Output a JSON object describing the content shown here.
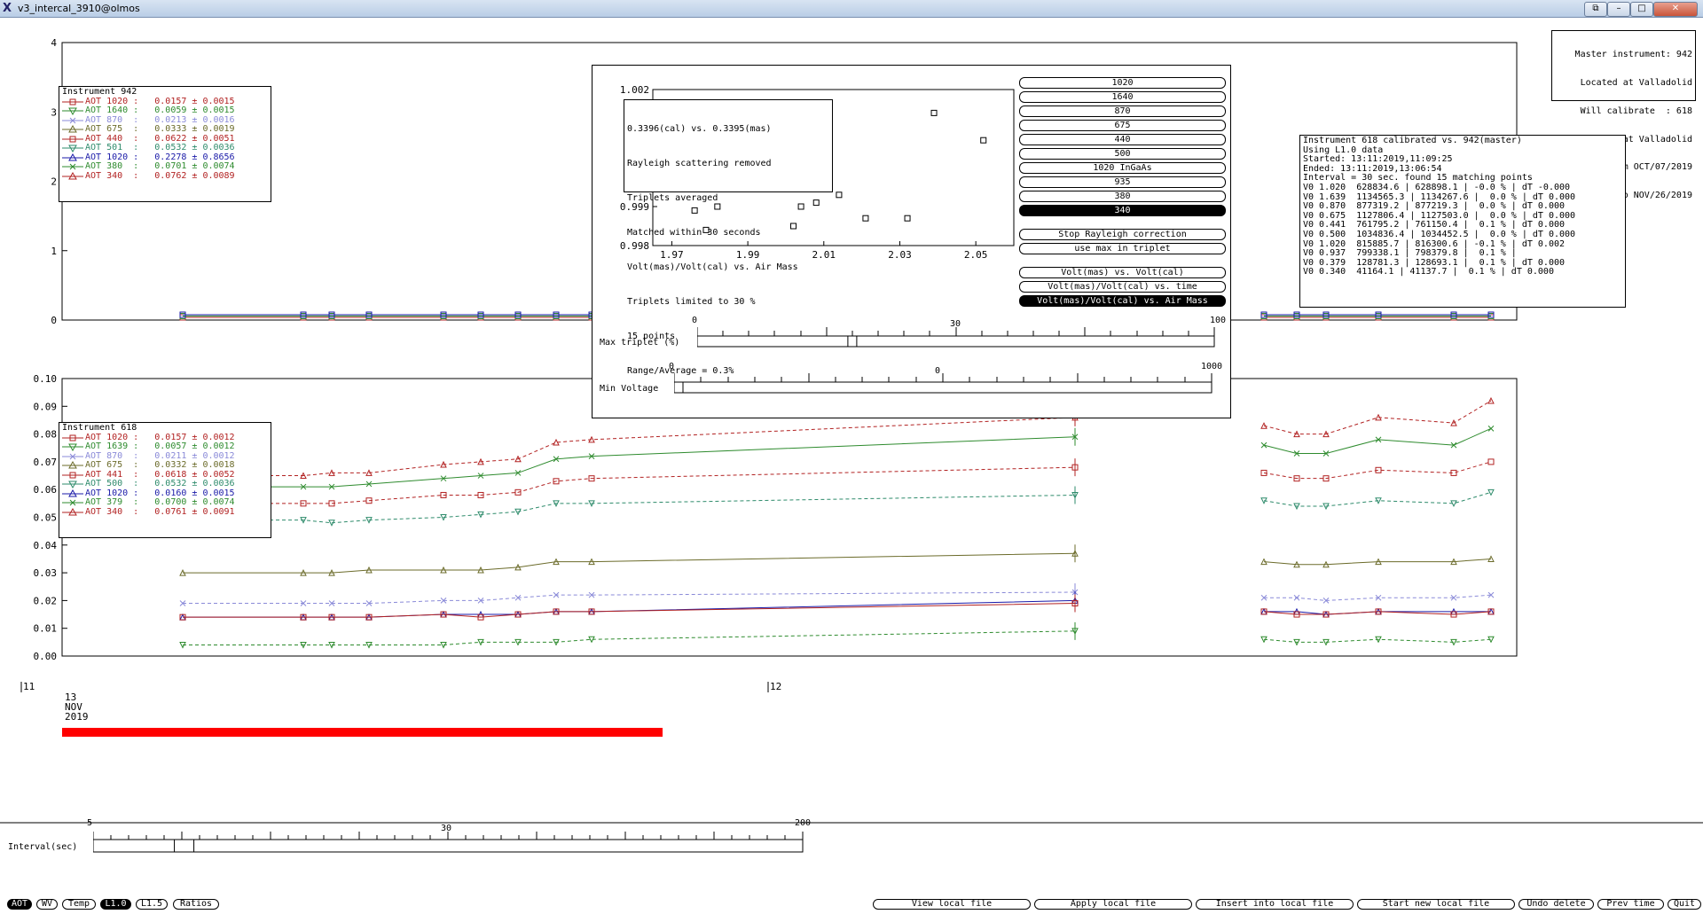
{
  "window": {
    "title": "v3_intercal_3910@olmos"
  },
  "master_box": {
    "lines": [
      "Master instrument: 942",
      "Located at Valladolid",
      "Will calibrate  : 618",
      "Located at Valladolid",
      "From OCT/07/2019",
      "To NOV/26/2019"
    ]
  },
  "calib_box": {
    "lines": [
      "Instrument 618 calibrated vs. 942(master)",
      "Using L1.0 data",
      "Started: 13:11:2019,11:09:25",
      "Ended: 13:11:2019,13:06:54",
      "Interval = 30 sec. found 15 matching points",
      "V0 1.020  628834.6 | 628898.1 | -0.0 % | dT -0.000",
      "V0 1.639  1134565.3 | 1134267.6 |  0.0 % | dT 0.000",
      "V0 0.870  877319.2 | 877219.3 |  0.0 % | dT 0.000",
      "V0 0.675  1127806.4 | 1127503.0 |  0.0 % | dT 0.000",
      "V0 0.441  761795.2 | 761150.4 |  0.1 % | dT 0.000",
      "V0 0.500  1034836.4 | 1034452.5 |  0.0 % | dT 0.000",
      "V0 1.020  815885.7 | 816300.6 | -0.1 % | dT 0.002",
      "V0 0.937  799338.1 | 798379.8 |  0.1 % |",
      "V0 0.379  128781.3 | 128693.1 |  0.1 % | dT 0.000",
      "V0 0.340  41164.1 | 41137.7 |  0.1 % | dT 0.000"
    ]
  },
  "top_plot": {
    "yticks": [
      "0",
      "1",
      "2",
      "3",
      "4"
    ],
    "legend_title": "Instrument 942",
    "legend": [
      {
        "label": "AOT 1020 :   0.0157 ± 0.0015",
        "color": "#b22222",
        "marker": "square"
      },
      {
        "label": "AOT 1640 :   0.0059 ± 0.0015",
        "color": "#2e8b2e",
        "marker": "triangle-down"
      },
      {
        "label": "AOT 870  :   0.0213 ± 0.0016",
        "color": "#8a8ad8",
        "marker": "x"
      },
      {
        "label": "AOT 675  :   0.0333 ± 0.0019",
        "color": "#6b6b2a",
        "marker": "triangle"
      },
      {
        "label": "AOT 440  :   0.0622 ± 0.0051",
        "color": "#b22222",
        "marker": "square"
      },
      {
        "label": "AOT 501  :   0.0532 ± 0.0036",
        "color": "#2e8b6b",
        "marker": "triangle-down"
      },
      {
        "label": "AOT 1020 :   0.2278 ± 0.8656",
        "color": "#1a1aa8",
        "marker": "triangle"
      },
      {
        "label": "AOT 380  :   0.0701 ± 0.0074",
        "color": "#2e8b2e",
        "marker": "x"
      },
      {
        "label": "AOT 340  :   0.0762 ± 0.0089",
        "color": "#b22222",
        "marker": "triangle"
      }
    ]
  },
  "bottom_plot": {
    "yticks": [
      "0.00",
      "0.01",
      "0.02",
      "0.03",
      "0.04",
      "0.05",
      "0.06",
      "0.07",
      "0.08",
      "0.09",
      "0.10"
    ],
    "legend_title": "Instrument 618",
    "legend": [
      {
        "label": "AOT 1020 :   0.0157 ± 0.0012",
        "color": "#b22222",
        "marker": "square"
      },
      {
        "label": "AOT 1639 :   0.0057 ± 0.0012",
        "color": "#2e8b2e",
        "marker": "triangle-down"
      },
      {
        "label": "AOT 870  :   0.0211 ± 0.0012",
        "color": "#8a8ad8",
        "marker": "x"
      },
      {
        "label": "AOT 675  :   0.0332 ± 0.0018",
        "color": "#6b6b2a",
        "marker": "triangle"
      },
      {
        "label": "AOT 441  :   0.0618 ± 0.0052",
        "color": "#b22222",
        "marker": "square"
      },
      {
        "label": "AOT 500  :   0.0532 ± 0.0036",
        "color": "#2e8b6b",
        "marker": "triangle-down"
      },
      {
        "label": "AOT 1020 :   0.0160 ± 0.0015",
        "color": "#1a1aa8",
        "marker": "triangle"
      },
      {
        "label": "AOT 379  :   0.0700 ± 0.0074",
        "color": "#2e8b2e",
        "marker": "x"
      },
      {
        "label": "AOT 340  :   0.0761 ± 0.0091",
        "color": "#b22222",
        "marker": "triangle"
      }
    ],
    "time_label_11": "11",
    "time_label_12": "12",
    "date_day": "13",
    "date_month": "NOV",
    "date_year": "2019"
  },
  "popup": {
    "ratio_text": [
      "0.3396(cal) vs. 0.3395(mas)",
      "Rayleigh scattering removed",
      "Triplets averaged",
      "Matched within 30 seconds",
      "Volt(mas)/Volt(cal) vs. Air Mass",
      "Triplets limited to 30 %",
      "15 points",
      "Range/Average = 0.3%"
    ],
    "wavelength_buttons": [
      "1020",
      "1640",
      "870",
      "675",
      "440",
      "500",
      "1020 InGaAs",
      "935",
      "380",
      "340"
    ],
    "selected_wavelength": "340",
    "action_buttons": [
      "Stop Rayleigh correction",
      "use max in triplet"
    ],
    "mode_buttons": [
      "Volt(mas) vs. Volt(cal)",
      "Volt(mas)/Volt(cal) vs. time",
      "Volt(mas)/Volt(cal) vs. Air Mass"
    ],
    "selected_mode": "Volt(mas)/Volt(cal) vs. Air Mass",
    "max_triplet": {
      "label": "Max triplet (%)",
      "min": "0",
      "max": "100",
      "value": "30",
      "value_num": 30
    },
    "min_voltage": {
      "label": "Min Voltage",
      "min": "0",
      "max": "1000",
      "value": "0",
      "value_num": 0
    },
    "mini_chart": {
      "yticks": [
        "0.998",
        "0.999",
        "1.002"
      ],
      "xticks": [
        "1.97",
        "1.99",
        "2.01",
        "2.03",
        "2.05"
      ]
    }
  },
  "chart_data": {
    "type": "scatter",
    "title": "",
    "xlabel": "",
    "ylabel": "",
    "xlim": [
      1.965,
      2.06
    ],
    "ylim": [
      0.998,
      1.002
    ],
    "series": [
      {
        "values": [
          {
            "x": 1.976,
            "y": 0.9989
          },
          {
            "x": 1.979,
            "y": 0.9984
          },
          {
            "x": 1.982,
            "y": 0.999
          },
          {
            "x": 2.0,
            "y": 1.0002
          },
          {
            "x": 2.002,
            "y": 0.9985
          },
          {
            "x": 2.004,
            "y": 0.999
          },
          {
            "x": 2.008,
            "y": 0.9991
          },
          {
            "x": 2.014,
            "y": 0.9993
          },
          {
            "x": 2.021,
            "y": 0.9987
          },
          {
            "x": 2.032,
            "y": 0.9987
          },
          {
            "x": 2.039,
            "y": 1.0014
          },
          {
            "x": 2.052,
            "y": 1.0007
          }
        ]
      }
    ]
  },
  "interval": {
    "label": "Interval(sec)",
    "min": "5",
    "mid": "30",
    "max": "200",
    "value_num": 30
  },
  "bottom_buttons": {
    "left": [
      "AOT",
      "WV",
      "Temp",
      "L1.0",
      "L1.5",
      "Ratios"
    ],
    "left_selected": [
      "AOT",
      "L1.0"
    ],
    "right": [
      "View local file",
      "Apply local file",
      "Insert into local file",
      "Start new local file",
      "Undo delete",
      "Prev time",
      "Quit"
    ]
  },
  "progress": {
    "fraction": 0.62,
    "color": "#ff0000"
  }
}
